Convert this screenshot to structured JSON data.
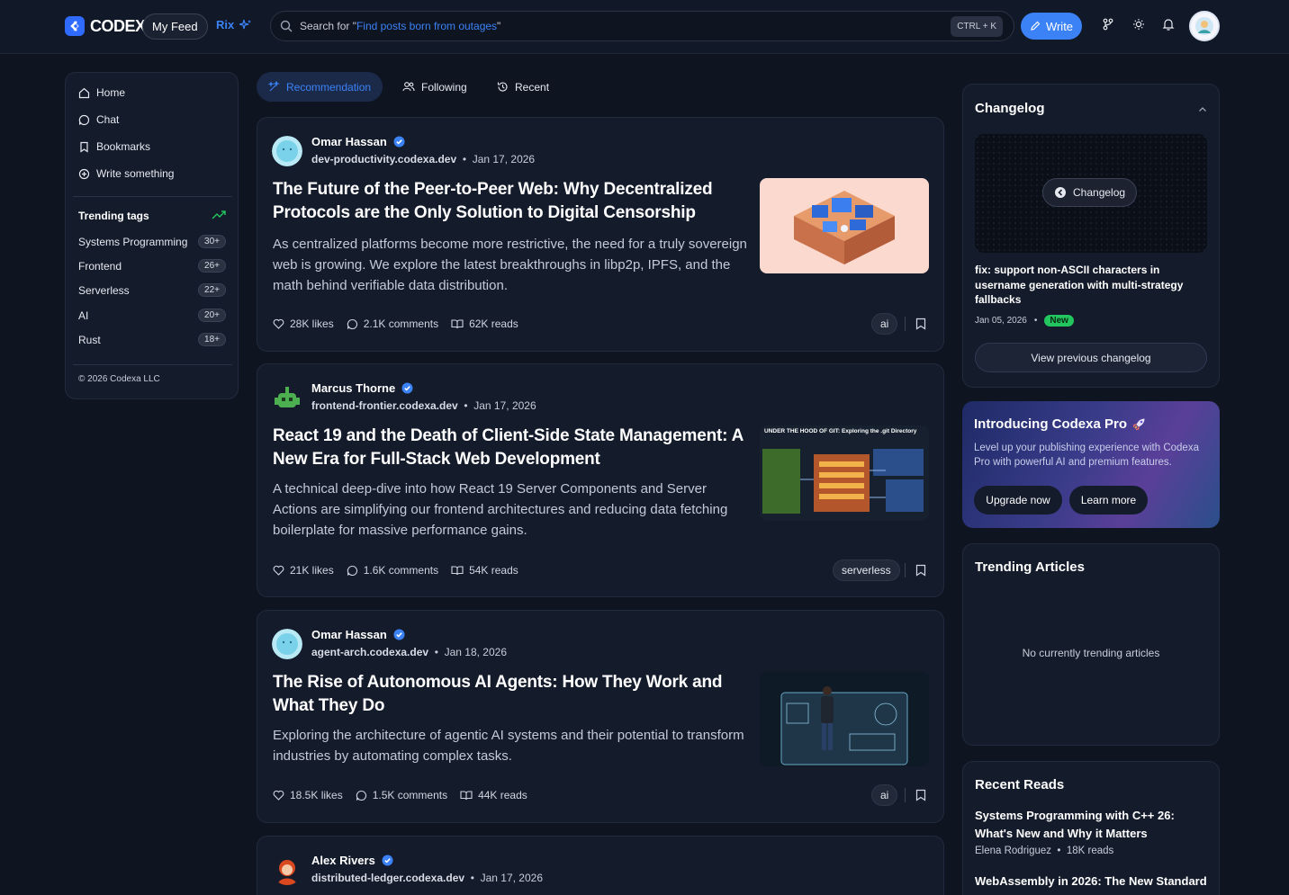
{
  "header": {
    "logo_text": "CODEXA",
    "my_feed": "My Feed",
    "rix": "Rix",
    "search_prefix": "Search for \"",
    "search_hint": "Find posts born from outages",
    "search_suffix": "\"",
    "shortcut": "CTRL + K",
    "write": "Write"
  },
  "sidebar": {
    "nav": [
      {
        "label": "Home",
        "icon": "home-icon"
      },
      {
        "label": "Chat",
        "icon": "chat-icon"
      },
      {
        "label": "Bookmarks",
        "icon": "bookmark-icon"
      },
      {
        "label": "Write something",
        "icon": "plus-circle-icon"
      }
    ],
    "trending_title": "Trending tags",
    "tags": [
      {
        "name": "Systems Programming",
        "count": "30+"
      },
      {
        "name": "Frontend",
        "count": "26+"
      },
      {
        "name": "Serverless",
        "count": "22+"
      },
      {
        "name": "AI",
        "count": "20+"
      },
      {
        "name": "Rust",
        "count": "18+"
      }
    ],
    "copyright": "© 2026 Codexa LLC"
  },
  "tabs": [
    {
      "label": "Recommendation",
      "active": true
    },
    {
      "label": "Following",
      "active": false
    },
    {
      "label": "Recent",
      "active": false
    }
  ],
  "posts": [
    {
      "author": "Omar Hassan",
      "domain": "dev-productivity.codexa.dev",
      "date": "Jan 17, 2026",
      "title": "The Future of the Peer-to-Peer Web: Why Decentralized Protocols are the Only Solution to Digital Censorship",
      "description": "As centralized platforms become more restrictive, the need for a truly sovereign web is growing. We explore the latest breakthroughs in libp2p, IPFS, and the math behind verifiable data distribution.",
      "likes": "28K likes",
      "comments": "2.1K comments",
      "reads": "62K reads",
      "tag": "ai"
    },
    {
      "author": "Marcus Thorne",
      "domain": "frontend-frontier.codexa.dev",
      "date": "Jan 17, 2026",
      "title": "React 19 and the Death of Client-Side State Management: A New Era for Full-Stack Web Development",
      "description": "A technical deep-dive into how React 19 Server Components and Server Actions are simplifying our frontend architectures and reducing data fetching boilerplate for massive performance gains.",
      "likes": "21K likes",
      "comments": "1.6K comments",
      "reads": "54K reads",
      "tag": "serverless",
      "thumb_caption": "UNDER THE HOOD OF GIT: Exploring the .git Directory"
    },
    {
      "author": "Omar Hassan",
      "domain": "agent-arch.codexa.dev",
      "date": "Jan 18, 2026",
      "title": "The Rise of Autonomous AI Agents: How They Work and What They Do",
      "description": "Exploring the architecture of agentic AI systems and their potential to transform industries by automating complex tasks.",
      "likes": "18.5K likes",
      "comments": "1.5K comments",
      "reads": "44K reads",
      "tag": "ai"
    },
    {
      "author": "Alex Rivers",
      "domain": "distributed-ledger.codexa.dev",
      "date": "Jan 17, 2026"
    }
  ],
  "changelog": {
    "title": "Changelog",
    "pill": "Changelog",
    "heading": "fix: support non-ASCII characters in username generation with multi-strategy fallbacks",
    "date": "Jan 05, 2026",
    "badge": "New",
    "button": "View previous changelog"
  },
  "pro": {
    "title": "Introducing Codexa Pro",
    "description": "Level up your publishing experience with Codexa Pro with powerful AI and premium features.",
    "upgrade": "Upgrade now",
    "learn": "Learn more"
  },
  "trending_articles": {
    "title": "Trending Articles",
    "empty": "No currently trending articles"
  },
  "recent_reads": {
    "title": "Recent Reads",
    "items": [
      {
        "title": "Systems Programming with C++ 26: What's New and Why it Matters",
        "author": "Elena Rodriguez",
        "reads": "18K reads"
      },
      {
        "title": "WebAssembly in 2026: The New Standard",
        "author": "",
        "reads": ""
      }
    ]
  },
  "colors": {
    "background": "#0f1421",
    "card": "#141b2b",
    "accent": "#3b82f6",
    "new_badge": "#22c55e"
  }
}
